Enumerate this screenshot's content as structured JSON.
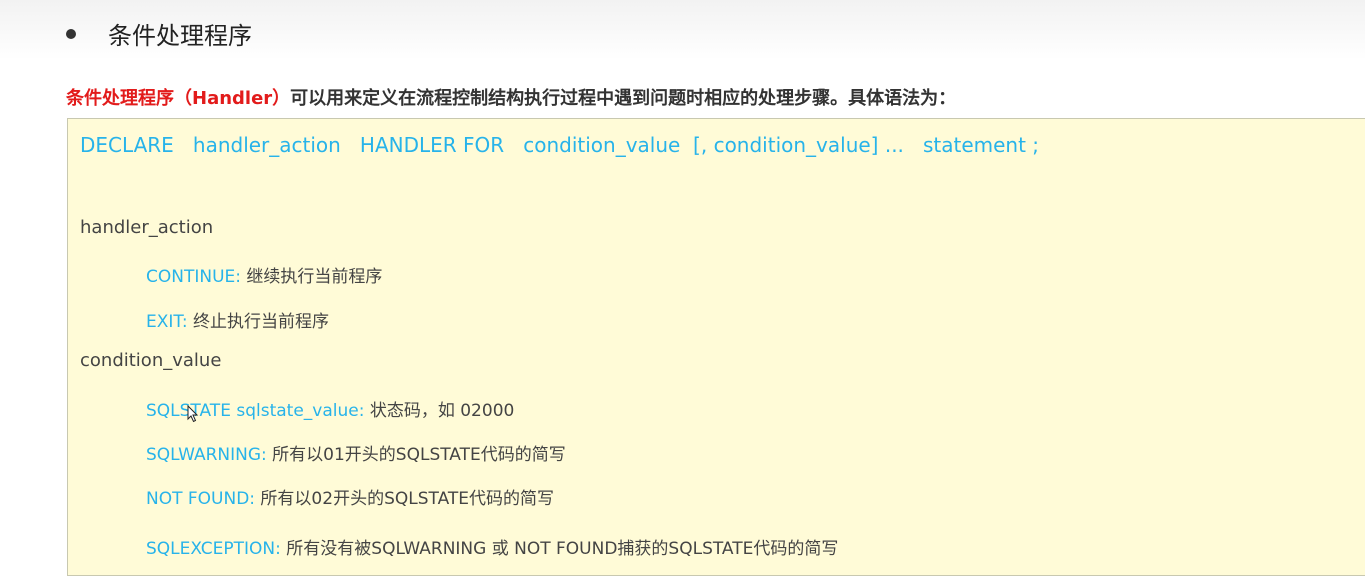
{
  "heading": {
    "text": "条件处理程序"
  },
  "intro": {
    "term": "条件处理程序（Handler）",
    "rest": "可以用来定义在流程控制结构执行过程中遇到问题时相应的处理步骤。具体语法为："
  },
  "syntax": "DECLARE   handler_action   HANDLER FOR   condition_value  [, condition_value] ...   statement ;",
  "sections": {
    "handler_action_label": "handler_action",
    "condition_value_label": "condition_value"
  },
  "items": [
    {
      "kw": "CONTINUE:",
      "desc": " 继续执行当前程序"
    },
    {
      "kw": "EXIT:",
      "desc": " 终止执行当前程序"
    },
    {
      "kw": "SQLSTATE  sqlstate_value:",
      "desc": " 状态码，如 02000"
    },
    {
      "kw": "SQLWARNING:",
      "desc": " 所有以01开头的SQLSTATE代码的简写"
    },
    {
      "kw": "NOT FOUND:",
      "desc": " 所有以02开头的SQLSTATE代码的简写"
    },
    {
      "kw": "SQLEXCEPTION:",
      "desc": " 所有没有被SQLWARNING 或 NOT FOUND捕获的SQLSTATE代码的简写"
    }
  ]
}
